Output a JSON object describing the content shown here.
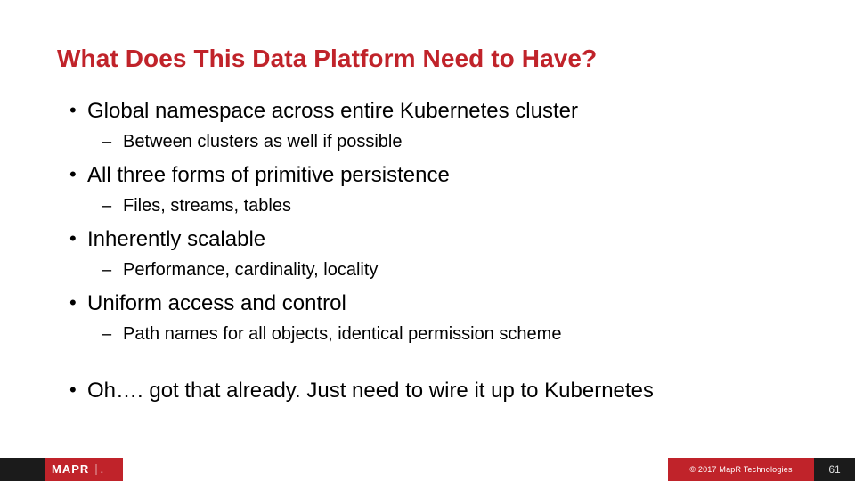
{
  "title": "What Does This Data Platform Need to Have?",
  "bullets": [
    {
      "text": "Global namespace across entire Kubernetes cluster",
      "sub": [
        "Between clusters as well if possible"
      ]
    },
    {
      "text": "All three forms of primitive persistence",
      "sub": [
        "Files, streams, tables"
      ]
    },
    {
      "text": "Inherently scalable",
      "sub": [
        "Performance, cardinality, locality"
      ]
    },
    {
      "text": "Uniform access and control",
      "sub": [
        "Path names for all objects, identical permission scheme"
      ]
    }
  ],
  "closing": "Oh…. got that already. Just need to wire it up to Kubernetes",
  "footer": {
    "logo_text": "MAPR",
    "copyright": "© 2017 MapR Technologies",
    "page_number": "61"
  }
}
